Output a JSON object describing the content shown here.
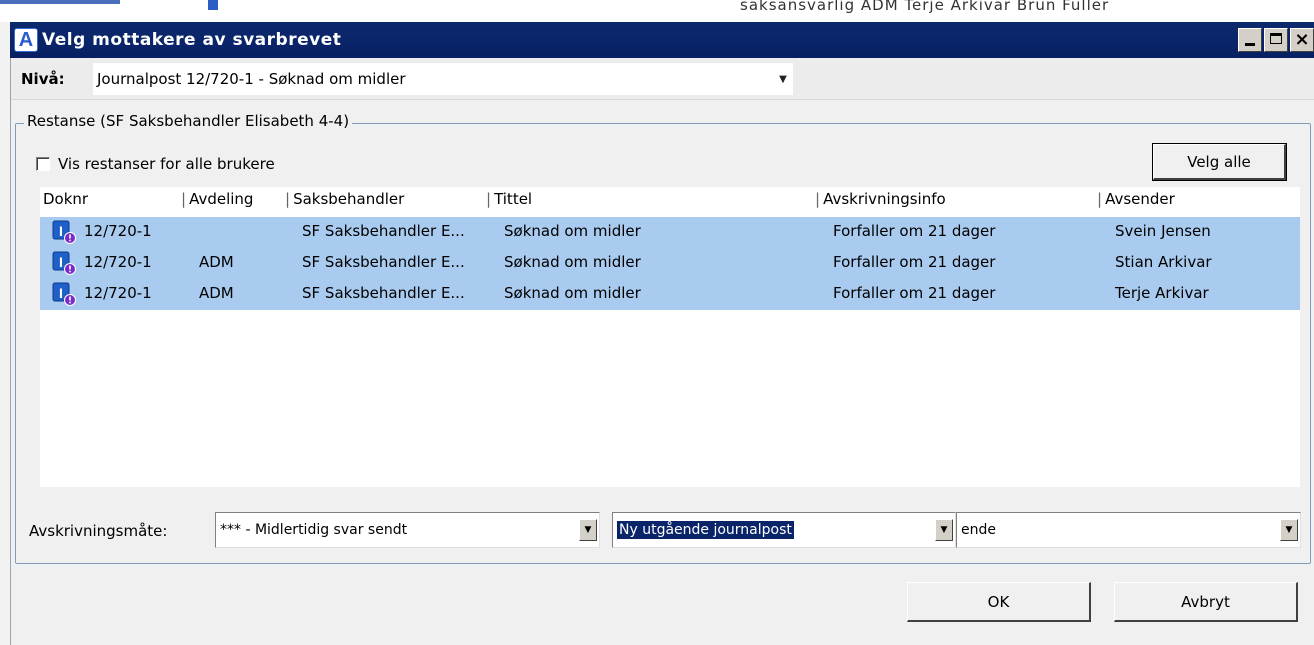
{
  "background": {
    "text": "saksansvarlig   ADM   Terje Arkivar   Brun Fuller"
  },
  "window": {
    "title": "Velg mottakere av svarbrevet",
    "app_icon_letter": "A",
    "close_glyph": "×"
  },
  "level": {
    "label": "Nivå:",
    "value": "Journalpost 12/720-1 - Søknad om midler"
  },
  "group": {
    "legend": "Restanse (SF Saksbehandler Elisabeth 4-4)",
    "show_all_label": "Vis restanser for alle brukere",
    "show_all_checked": false,
    "select_all_label": "Velg alle"
  },
  "list": {
    "columns": [
      "Doknr",
      "Avdeling",
      "Saksbehandler",
      "Tittel",
      "Avskrivningsinfo",
      "Avsender"
    ],
    "rows": [
      {
        "doknr": "12/720-1",
        "avdeling": "",
        "saksbehandler": "SF Saksbehandler E...",
        "tittel": "Søknad om midler",
        "avskrivningsinfo": "Forfaller om 21 dager",
        "avsender": "Svein Jensen",
        "selected": true
      },
      {
        "doknr": "12/720-1",
        "avdeling": "ADM",
        "saksbehandler": "SF Saksbehandler E...",
        "tittel": "Søknad om midler",
        "avskrivningsinfo": "Forfaller om 21 dager",
        "avsender": "Stian Arkivar",
        "selected": true
      },
      {
        "doknr": "12/720-1",
        "avdeling": "ADM",
        "saksbehandler": "SF Saksbehandler E...",
        "tittel": "Søknad om midler",
        "avskrivningsinfo": "Forfaller om 21 dager",
        "avsender": "Terje Arkivar",
        "selected": true
      }
    ],
    "row_icon": "incoming-document-icon"
  },
  "avskrivning": {
    "label": "Avskrivningsmåte:",
    "mode_value": "*** - Midlertidig svar sendt",
    "type_value": "Ny utgående journalpost",
    "third_value": "ende"
  },
  "buttons": {
    "ok": "OK",
    "cancel": "Avbryt"
  },
  "colors": {
    "titlebar": "#0a246a",
    "selection": "#a9cbef",
    "focus_highlight": "#0a246a"
  }
}
